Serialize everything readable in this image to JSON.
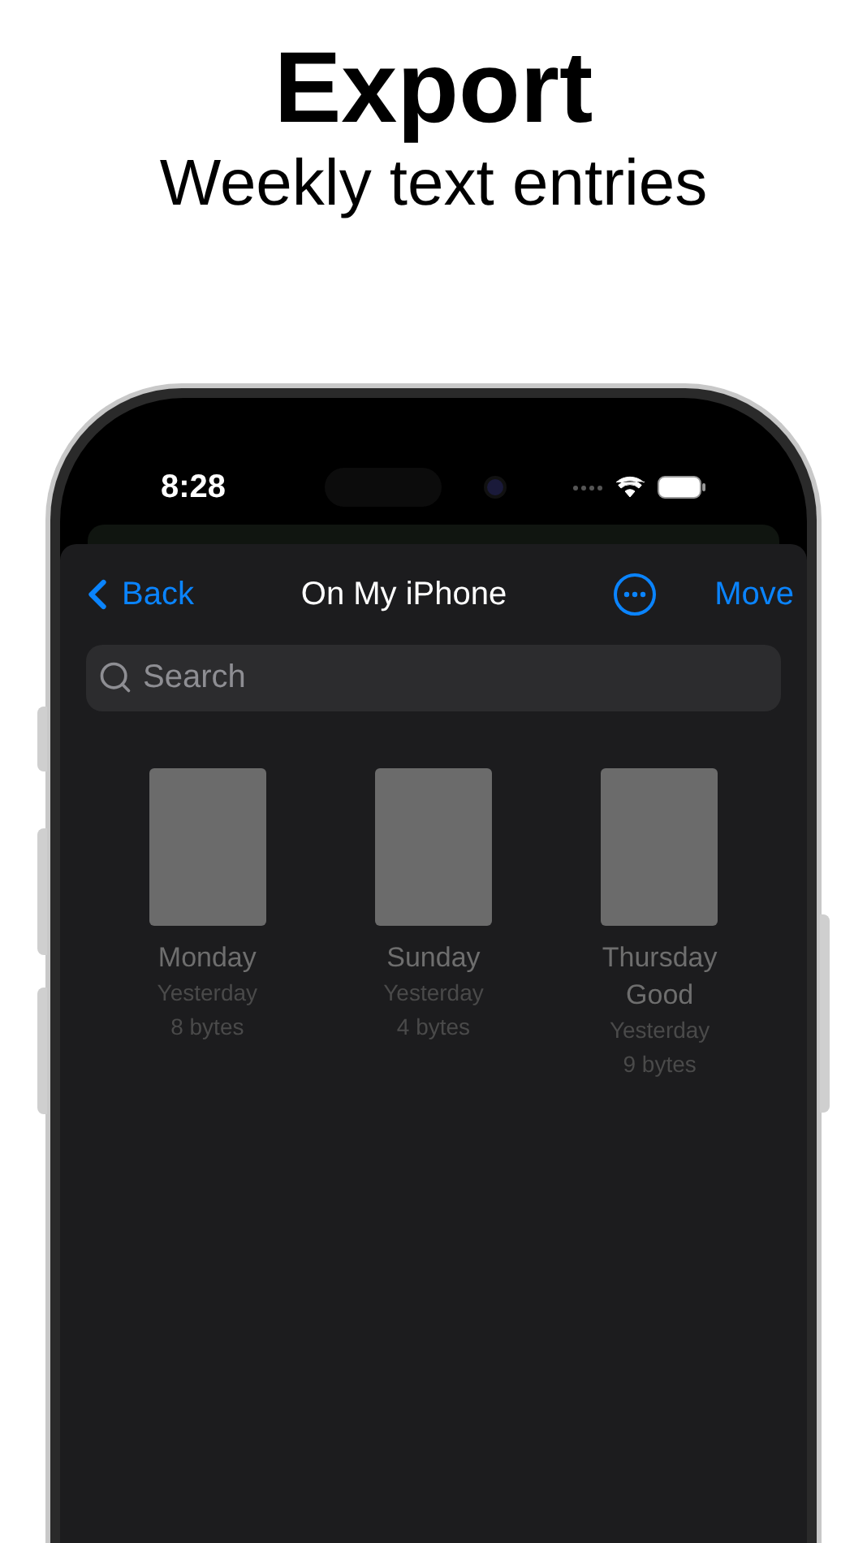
{
  "headline": {
    "title": "Export",
    "subtitle": "Weekly text entries"
  },
  "status_bar": {
    "time": "8:28"
  },
  "nav": {
    "back": "Back",
    "title": "On My iPhone",
    "action": "Move"
  },
  "search": {
    "placeholder": "Search"
  },
  "files": [
    {
      "name": "Monday",
      "date": "Yesterday",
      "size": "8 bytes"
    },
    {
      "name": "Sunday",
      "date": "Yesterday",
      "size": "4 bytes"
    },
    {
      "name": "Thursday Good",
      "date": "Yesterday",
      "size": "9 bytes"
    }
  ]
}
